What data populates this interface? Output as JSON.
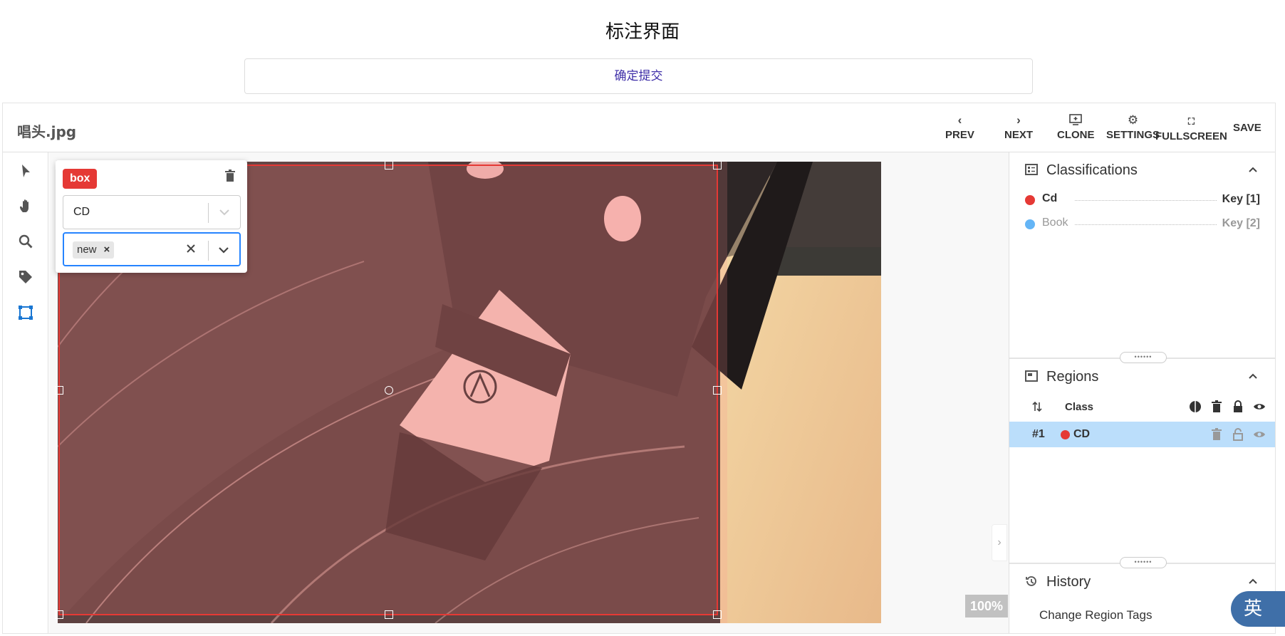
{
  "page": {
    "title": "标注界面",
    "submit_label": "确定提交"
  },
  "header": {
    "file_name": "唱头.jpg",
    "buttons": {
      "prev": "PREV",
      "next": "NEXT",
      "clone": "CLONE",
      "settings": "SETTINGS",
      "fullscreen": "FULLSCREEN",
      "save": "SAVE"
    }
  },
  "tools": [
    "select-tool-icon",
    "pan-tool-icon",
    "zoom-tool-icon",
    "tag-tool-icon",
    "box-tool-icon"
  ],
  "region_editor": {
    "region_type": "box",
    "class_value": "CD",
    "tags": [
      "new"
    ]
  },
  "canvas": {
    "zoom": "100%",
    "region_color": "#e53935"
  },
  "classifications": {
    "title": "Classifications",
    "items": [
      {
        "name": "Cd",
        "key": "Key [1]",
        "color": "#e53935"
      },
      {
        "name": "Book",
        "key": "Key [2]",
        "color": "#64b5f6"
      }
    ]
  },
  "regions": {
    "title": "Regions",
    "class_header": "Class",
    "rows": [
      {
        "id": "#1",
        "class": "CD",
        "color": "#e53935"
      }
    ]
  },
  "history": {
    "title": "History",
    "items": [
      "Change Region Tags"
    ]
  },
  "ime_indicator": "英"
}
